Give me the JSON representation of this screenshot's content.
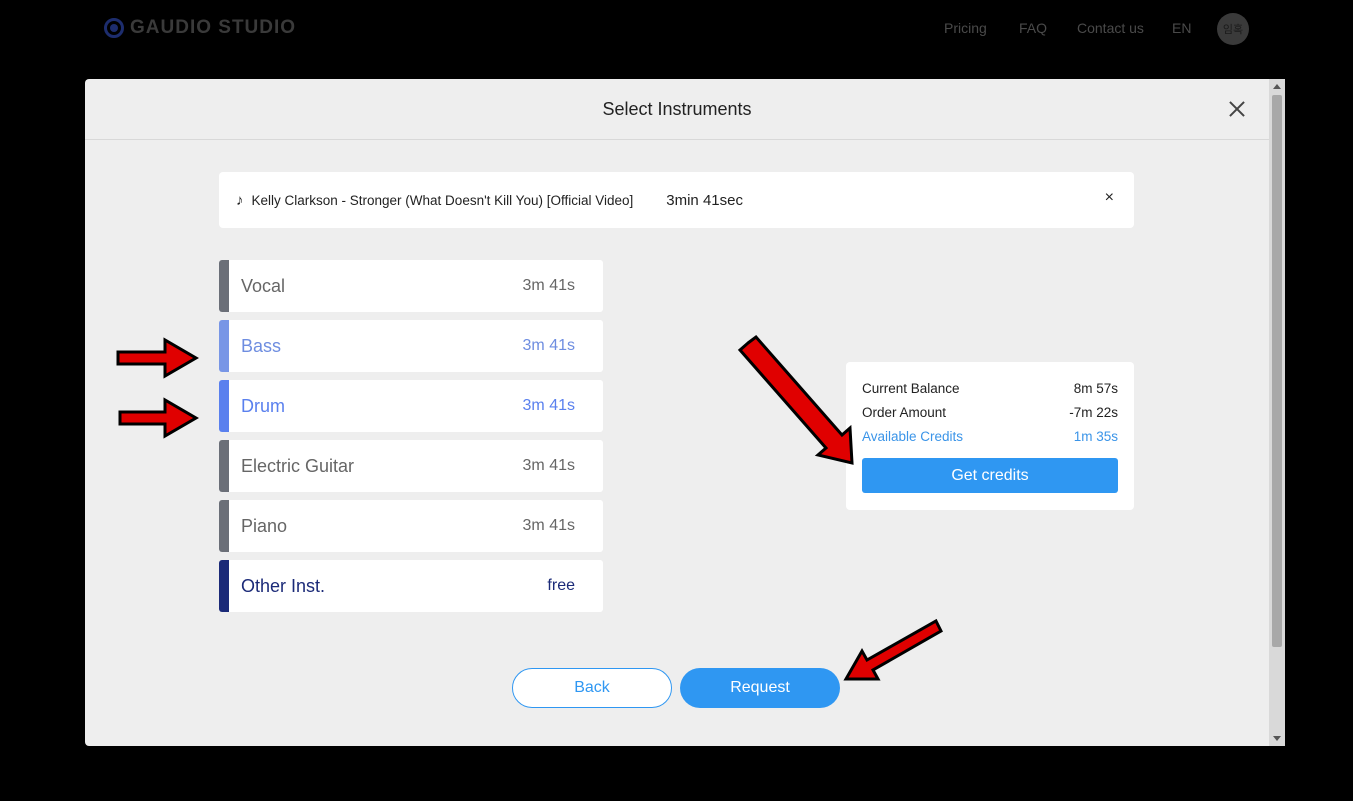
{
  "nav": {
    "logo_text": "GAUDIO STUDIO",
    "links": [
      "Pricing",
      "FAQ",
      "Contact us",
      "EN"
    ],
    "avatar_text": "임혹"
  },
  "modal": {
    "title": "Select Instruments",
    "track": {
      "name": "Kelly Clarkson - Stronger (What Doesn't Kill You) [Official Video]",
      "duration": "3min 41sec",
      "remove_label": "×"
    },
    "instruments": [
      {
        "label": "Vocal",
        "time": "3m 41s",
        "selected": false,
        "bar_color": "#6b6f78",
        "text_color": "#666666"
      },
      {
        "label": "Bass",
        "time": "3m 41s",
        "selected": true,
        "bar_color": "#7896e6",
        "text_color": "#6e8de0"
      },
      {
        "label": "Drum",
        "time": "3m 41s",
        "selected": true,
        "bar_color": "#5a80ee",
        "text_color": "#5a80ee"
      },
      {
        "label": "Electric Guitar",
        "time": "3m 41s",
        "selected": false,
        "bar_color": "#6b6f78",
        "text_color": "#666666"
      },
      {
        "label": "Piano",
        "time": "3m 41s",
        "selected": false,
        "bar_color": "#6b6f78",
        "text_color": "#666666"
      },
      {
        "label": "Other Inst.",
        "time": "free",
        "selected": true,
        "bar_color": "#1b2a78",
        "text_color": "#1b2a78"
      }
    ],
    "credits": {
      "current_balance_label": "Current Balance",
      "current_balance_value": "8m 57s",
      "order_amount_label": "Order Amount",
      "order_amount_value": "-7m 22s",
      "available_label": "Available Credits",
      "available_value": "1m 35s",
      "get_credits_label": "Get credits"
    },
    "back_label": "Back",
    "request_label": "Request"
  },
  "colors": {
    "accent": "#2f97f2",
    "annotation_arrow": "#e00000"
  }
}
